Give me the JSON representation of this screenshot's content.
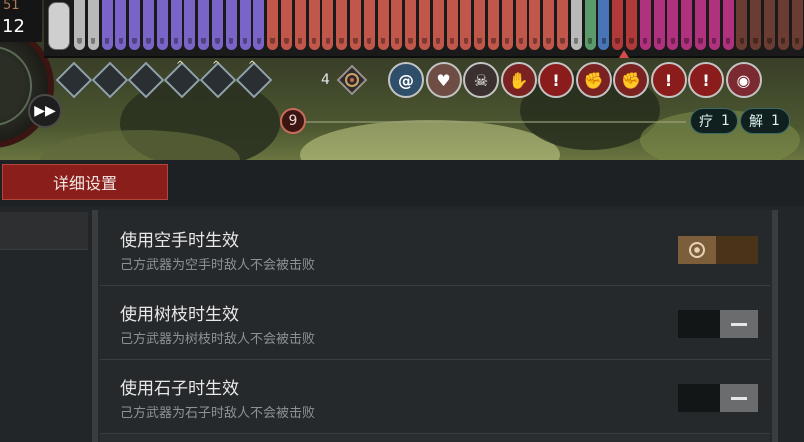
{
  "hud": {
    "counter_top": "51",
    "counter_main": "12",
    "card_colors": {
      "silver": "#b9b9b9",
      "violet": "#7a64c8",
      "terracotta": "#c0574a",
      "green": "#5b9a6a",
      "blue": "#4a74b8",
      "red": "#b03a3a",
      "magenta": "#b0317e",
      "brown": "#6a3c32"
    },
    "skill_icons": [
      "rune-diamond-icon",
      "rune-diamond-icon",
      "rune-diamond-icon",
      "rune-diamond-icon",
      "rune-diamond-icon",
      "rune-diamond-icon"
    ],
    "stack_count": "4",
    "effect_icons": [
      {
        "name": "swirl-effect-icon",
        "color": "#2e4e6a",
        "glyph": "@"
      },
      {
        "name": "heart-effect-icon",
        "color": "#6e4e44",
        "glyph": "♥"
      },
      {
        "name": "skull-effect-icon",
        "color": "#3a3030",
        "glyph": "☠"
      },
      {
        "name": "hand-effect-icon",
        "color": "#7a2222",
        "glyph": "✋"
      },
      {
        "name": "warning-effect-icon",
        "color": "#8a1c1c",
        "glyph": "!"
      },
      {
        "name": "grab-effect-icon",
        "color": "#7a2222",
        "glyph": "✊"
      },
      {
        "name": "grab-effect-icon",
        "color": "#7a2222",
        "glyph": "✊"
      },
      {
        "name": "warning-effect-icon",
        "color": "#8a1c1c",
        "glyph": "!"
      },
      {
        "name": "warning-effect-icon",
        "color": "#8a1c1c",
        "glyph": "!"
      },
      {
        "name": "beast-effect-icon",
        "color": "#7a2a30",
        "glyph": "◉"
      }
    ],
    "turn_badge": "9",
    "heal_label": "疗",
    "heal_count": "1",
    "solve_label": "解",
    "solve_count": "1"
  },
  "panel": {
    "header_title": "详细设置",
    "settings": [
      {
        "title": "使用空手时生效",
        "subtitle": "己方武器为空手时敌人不会被击败",
        "enabled": true
      },
      {
        "title": "使用树枝时生效",
        "subtitle": "己方武器为树枝时敌人不会被击败",
        "enabled": false
      },
      {
        "title": "使用石子时生效",
        "subtitle": "己方武器为石子时敌人不会被击败",
        "enabled": false
      }
    ]
  }
}
